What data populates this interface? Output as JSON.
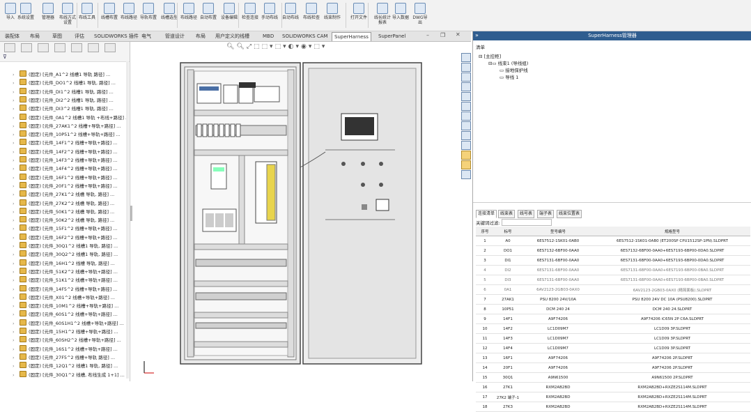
{
  "ribbon": {
    "items": [
      {
        "label": "导入"
      },
      {
        "label": "系统设置"
      },
      {
        "label": "管理器"
      },
      {
        "label": "布线方式设置"
      },
      {
        "label": "布线工具"
      },
      {
        "label": "线槽布置"
      },
      {
        "label": "布线路径"
      },
      {
        "label": "导轨布置"
      },
      {
        "label": "线槽选型"
      },
      {
        "label": "布线路径"
      },
      {
        "label": "自动布置"
      },
      {
        "label": "设备编辑"
      },
      {
        "label": "检查连接"
      },
      {
        "label": "手动布线"
      },
      {
        "label": "自动布线"
      },
      {
        "label": "布线检查"
      },
      {
        "label": "线束制作"
      },
      {
        "label": "打开文件"
      },
      {
        "label": "线长统计报表"
      },
      {
        "label": "导入数据"
      },
      {
        "label": "DWG导出"
      }
    ]
  },
  "tabs": [
    {
      "label": "装配体"
    },
    {
      "label": "布局"
    },
    {
      "label": "草图"
    },
    {
      "label": "评估"
    },
    {
      "label": "SOLIDWORKS 插件"
    },
    {
      "label": "电气"
    },
    {
      "label": "管道设计"
    },
    {
      "label": "布局"
    },
    {
      "label": "用户定义的线槽"
    },
    {
      "label": "MBD"
    },
    {
      "label": "SOLIDWORKS CAM"
    },
    {
      "label": "SuperHarness"
    },
    {
      "label": "SuperPanel"
    }
  ],
  "active_tab_index": 11,
  "tree": {
    "rows": [
      "(固定) [元件_A1^2 线槽1 导轨 路径] ...",
      "(固定) [元件_DO1^2 线槽1 导轨, 路径] ...",
      "(固定) [元件_DI1^2 线槽1 导轨, 路径] ...",
      "(固定) [元件_DI2^2 线槽1 导轨, 路径] ...",
      "(固定) [元件_DI3^2 线槽1 导轨, 路径] ...",
      "(固定) [元件_0A1^2 线槽1 导轨 +布线+路径] ...",
      "(固定) [元件_27AK1^2 线槽+导轨+路径] ...",
      "(固定) [元件_10P51^2 线槽+导轨+路径] ...",
      "(固定) [元件_14F1^2 线槽+导轨+路径] ...",
      "(固定) [元件_14F2^2 线槽+导轨+路径] ...",
      "(固定) [元件_14F3^2 线槽+导轨+路径] ...",
      "(固定) [元件_14F4^2 线槽+导轨+路径] ...",
      "(固定) [元件_16F1^2 线槽+导轨+路径] ...",
      "(固定) [元件_20F1^2 线槽+导轨+路径] ...",
      "(固定) [元件_27K1^2 线槽 导轨, 路径] ...",
      "(固定) [元件_27K2^2 线槽 导轨, 路径] ...",
      "(固定) [元件_50K1^2 线槽 导轨, 路径] ...",
      "(固定) [元件_50K2^2 线槽 导轨, 路径] ...",
      "(固定) [元件_15F1^2 线槽+导轨+路径] ...",
      "(固定) [元件_16F2^2 线槽+导轨+路径] ...",
      "(固定) [元件_30Q1^2 线槽1 导轨, 路径] ...",
      "(固定) [元件_30Q2^2 线槽1 导轨, 路径] ...",
      "(固定) [元件_16H1^2 线槽 导轨, 路径] ...",
      "(固定) [元件_51K2^2 线槽+导轨+路径] ...",
      "(固定) [元件_51K1^2 线槽+导轨+路径] ...",
      "(固定) [元件_14F5^2 线槽+导轨+路径] ...",
      "(固定) [元件_X01^2 线槽+导轨+路径] ...",
      "(固定) [元件_10M1^2 线槽+导轨+路径] ...",
      "(固定) [元件_60S1^2 线槽+导轨+路径] ...",
      "(固定) [元件_60S1H1^2 线槽+导轨+路径] ...",
      "(固定) [元件_15H1^2 线槽+导轨+路径] ...",
      "(固定) [元件_60SH2^2 线槽+导轨+路径] ...",
      "(固定) [元件_16S1^2 线槽+导轨+路径] ...",
      "(固定) [元件_27F5^2 线槽+导轨 路径] ...",
      "(固定) [元件_12Q1^2 线槽1 导轨, 路径] ...",
      "(固定) [元件_30Q1^2 线槽, 布线生成 1+1] ..."
    ]
  },
  "right_panel": {
    "title": "SuperHarness管理器",
    "tree_header": "清单",
    "tree_root": "[主控柜]",
    "tree_items": [
      "线束1 (导线组)",
      "接地保护线",
      "导线 1"
    ],
    "tabs": [
      "连接清单",
      "线束表",
      "线号表",
      "端子表",
      "线束位置表"
    ],
    "filter_label": "关键词过滤:",
    "table": {
      "headers": [
        "序号",
        "标号",
        "型号编号",
        "规格型号"
      ],
      "rows": [
        [
          "1",
          "A0",
          "6ES7512-1SK01-0AB0",
          "6ES7512-1SK01-0AB0 (ET200SP CPU1512SP-1PN).SLDPRT"
        ],
        [
          "2",
          "DO1",
          "6ES7132-6BF00-0AA0",
          "6ES7132-6BF00-0AA0+6ES7193-6BP00-0DA0.SLDPRT"
        ],
        [
          "3",
          "DI1",
          "6ES7131-6BF00-0AA0",
          "6ES7131-6BF00-0AA0+6ES7193-6BP00-0DA0.SLDPRT"
        ],
        [
          "4",
          "DI2",
          "6ES7131-6BF00-0AA0",
          "6ES7131-6BF00-0AA0+6ES7193-6BP00-0BA0.SLDPRT"
        ],
        [
          "5",
          "DI3",
          "6ES7131-6BF00-0AA0",
          "6ES7131-6BF00-0AA0+6ES7193-6BP00-0BA0.SLDPRT"
        ],
        [
          "6",
          "0A1",
          "6AV2123-2GB03-0AX0",
          "6AV2123-2GB03-0AX0 (精简面板).SLDPRT"
        ],
        [
          "7",
          "27AK1",
          "PSU 8200 24V/10A",
          "PSU 8200 24V DC 10A (PSU8200).SLDPRT"
        ],
        [
          "8",
          "10P51",
          "DCM 240 24",
          "DCM 240 24.SLDPRT"
        ],
        [
          "9",
          "14F1",
          "A9F74206",
          "A9F74206 iC65N 2P C6A.SLDPRT"
        ],
        [
          "10",
          "14F2",
          "LC1D09M7",
          "LC1D09 3P.SLDPRT"
        ],
        [
          "11",
          "14F3",
          "LC1D09M7",
          "LC1D09 3P.SLDPRT"
        ],
        [
          "12",
          "14F4",
          "LC1D09M7",
          "LC1D09 3P.SLDPRT"
        ],
        [
          "13",
          "16F1",
          "A9F74206",
          "A9F74206 2P.SLDPRT"
        ],
        [
          "14",
          "20F1",
          "A9F74206",
          "A9F74206 2P.SLDPRT"
        ],
        [
          "15",
          "30Q1",
          "A9N61500",
          "A9N61500 2P.SLDPRT"
        ],
        [
          "16",
          "27K1",
          "RXM2AB2BD",
          "RXM2AB2BD+RXZE2S114M.SLDPRT"
        ],
        [
          "17",
          "27K2 端子-1",
          "RXM2AB2BD",
          "RXM2AB2BD+RXZE2S114M.SLDPRT"
        ],
        [
          "18",
          "27K3",
          "RXM2AB2BD",
          "RXM2AB2BD+RXZE2S114M.SLDPRT"
        ]
      ]
    }
  }
}
